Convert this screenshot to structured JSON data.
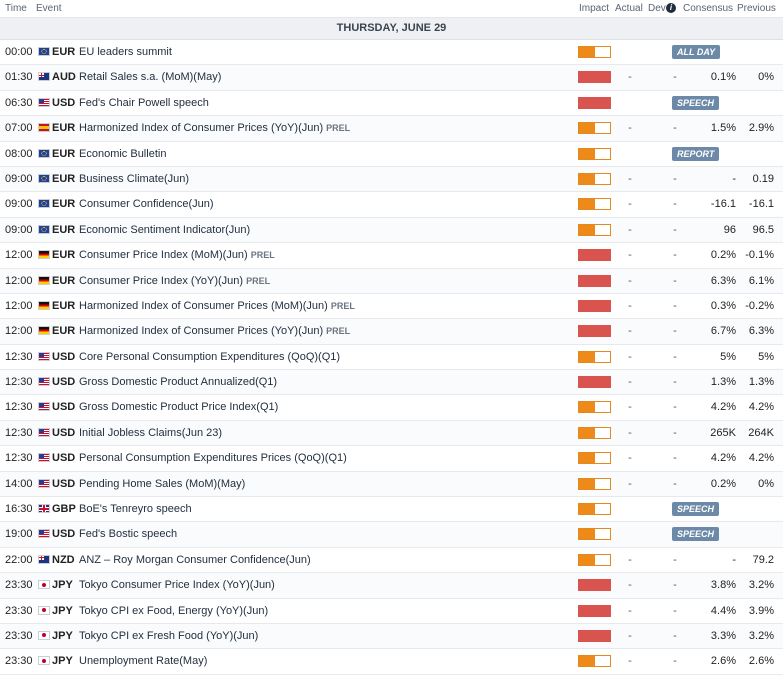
{
  "header": {
    "time": "Time",
    "event": "Event",
    "impact": "Impact",
    "actual": "Actual",
    "dev": "Dev",
    "info_icon": "i",
    "consensus": "Consensus",
    "previous": "Previous"
  },
  "day_label": "THURSDAY, JUNE 29",
  "colors": {
    "impact_medium": "#ee8a1a",
    "impact_high": "#d9534f",
    "badge": "#6c8aa8",
    "day_bg": "#eef0f3"
  },
  "events": [
    {
      "time": "00:00",
      "flag": "eu",
      "cur": "EUR",
      "event": "EU leaders summit",
      "prel": "",
      "impact": "medium",
      "impact_level": 0.5,
      "actual": "",
      "dev": "",
      "cons": "",
      "prev": "",
      "badge": "ALL DAY"
    },
    {
      "time": "01:30",
      "flag": "au",
      "cur": "AUD",
      "event": "Retail Sales s.a. (MoM)(May)",
      "prel": "",
      "impact": "high",
      "impact_level": 1.0,
      "actual": "-",
      "dev": "-",
      "cons": "0.1%",
      "prev": "0%",
      "badge": ""
    },
    {
      "time": "06:30",
      "flag": "us",
      "cur": "USD",
      "event": "Fed's Chair Powell speech",
      "prel": "",
      "impact": "high",
      "impact_level": 1.0,
      "actual": "",
      "dev": "",
      "cons": "",
      "prev": "",
      "badge": "SPEECH"
    },
    {
      "time": "07:00",
      "flag": "es",
      "cur": "EUR",
      "event": "Harmonized Index of Consumer Prices (YoY)(Jun)",
      "prel": "PREL",
      "impact": "medium",
      "impact_level": 0.5,
      "actual": "-",
      "dev": "-",
      "cons": "1.5%",
      "prev": "2.9%",
      "badge": ""
    },
    {
      "time": "08:00",
      "flag": "eu",
      "cur": "EUR",
      "event": "Economic Bulletin",
      "prel": "",
      "impact": "medium",
      "impact_level": 0.5,
      "actual": "",
      "dev": "",
      "cons": "",
      "prev": "",
      "badge": "REPORT"
    },
    {
      "time": "09:00",
      "flag": "eu",
      "cur": "EUR",
      "event": "Business Climate(Jun)",
      "prel": "",
      "impact": "medium",
      "impact_level": 0.5,
      "actual": "-",
      "dev": "-",
      "cons": "-",
      "prev": "0.19",
      "badge": ""
    },
    {
      "time": "09:00",
      "flag": "eu",
      "cur": "EUR",
      "event": "Consumer Confidence(Jun)",
      "prel": "",
      "impact": "medium",
      "impact_level": 0.5,
      "actual": "-",
      "dev": "-",
      "cons": "-16.1",
      "prev": "-16.1",
      "badge": ""
    },
    {
      "time": "09:00",
      "flag": "eu",
      "cur": "EUR",
      "event": "Economic Sentiment Indicator(Jun)",
      "prel": "",
      "impact": "medium",
      "impact_level": 0.5,
      "actual": "-",
      "dev": "-",
      "cons": "96",
      "prev": "96.5",
      "badge": ""
    },
    {
      "time": "12:00",
      "flag": "de",
      "cur": "EUR",
      "event": "Consumer Price Index (MoM)(Jun)",
      "prel": "PREL",
      "impact": "high",
      "impact_level": 1.0,
      "actual": "-",
      "dev": "-",
      "cons": "0.2%",
      "prev": "-0.1%",
      "badge": ""
    },
    {
      "time": "12:00",
      "flag": "de",
      "cur": "EUR",
      "event": "Consumer Price Index (YoY)(Jun)",
      "prel": "PREL",
      "impact": "high",
      "impact_level": 1.0,
      "actual": "-",
      "dev": "-",
      "cons": "6.3%",
      "prev": "6.1%",
      "badge": ""
    },
    {
      "time": "12:00",
      "flag": "de",
      "cur": "EUR",
      "event": "Harmonized Index of Consumer Prices (MoM)(Jun)",
      "prel": "PREL",
      "impact": "high",
      "impact_level": 1.0,
      "actual": "-",
      "dev": "-",
      "cons": "0.3%",
      "prev": "-0.2%",
      "badge": ""
    },
    {
      "time": "12:00",
      "flag": "de",
      "cur": "EUR",
      "event": "Harmonized Index of Consumer Prices (YoY)(Jun)",
      "prel": "PREL",
      "impact": "high",
      "impact_level": 1.0,
      "actual": "-",
      "dev": "-",
      "cons": "6.7%",
      "prev": "6.3%",
      "badge": ""
    },
    {
      "time": "12:30",
      "flag": "us",
      "cur": "USD",
      "event": "Core Personal Consumption Expenditures (QoQ)(Q1)",
      "prel": "",
      "impact": "medium",
      "impact_level": 0.5,
      "actual": "-",
      "dev": "-",
      "cons": "5%",
      "prev": "5%",
      "badge": ""
    },
    {
      "time": "12:30",
      "flag": "us",
      "cur": "USD",
      "event": "Gross Domestic Product Annualized(Q1)",
      "prel": "",
      "impact": "high",
      "impact_level": 1.0,
      "actual": "-",
      "dev": "-",
      "cons": "1.3%",
      "prev": "1.3%",
      "badge": ""
    },
    {
      "time": "12:30",
      "flag": "us",
      "cur": "USD",
      "event": "Gross Domestic Product Price Index(Q1)",
      "prel": "",
      "impact": "medium",
      "impact_level": 0.5,
      "actual": "-",
      "dev": "-",
      "cons": "4.2%",
      "prev": "4.2%",
      "badge": ""
    },
    {
      "time": "12:30",
      "flag": "us",
      "cur": "USD",
      "event": "Initial Jobless Claims(Jun 23)",
      "prel": "",
      "impact": "medium",
      "impact_level": 0.5,
      "actual": "-",
      "dev": "-",
      "cons": "265K",
      "prev": "264K",
      "badge": ""
    },
    {
      "time": "12:30",
      "flag": "us",
      "cur": "USD",
      "event": "Personal Consumption Expenditures Prices (QoQ)(Q1)",
      "prel": "",
      "impact": "medium",
      "impact_level": 0.5,
      "actual": "-",
      "dev": "-",
      "cons": "4.2%",
      "prev": "4.2%",
      "badge": ""
    },
    {
      "time": "14:00",
      "flag": "us",
      "cur": "USD",
      "event": "Pending Home Sales (MoM)(May)",
      "prel": "",
      "impact": "medium",
      "impact_level": 0.5,
      "actual": "-",
      "dev": "-",
      "cons": "0.2%",
      "prev": "0%",
      "badge": ""
    },
    {
      "time": "16:30",
      "flag": "gb",
      "cur": "GBP",
      "event": "BoE's Tenreyro speech",
      "prel": "",
      "impact": "medium",
      "impact_level": 0.5,
      "actual": "",
      "dev": "",
      "cons": "",
      "prev": "",
      "badge": "SPEECH"
    },
    {
      "time": "19:00",
      "flag": "us",
      "cur": "USD",
      "event": "Fed's Bostic speech",
      "prel": "",
      "impact": "medium",
      "impact_level": 0.5,
      "actual": "",
      "dev": "",
      "cons": "",
      "prev": "",
      "badge": "SPEECH"
    },
    {
      "time": "22:00",
      "flag": "nz",
      "cur": "NZD",
      "event": "ANZ – Roy Morgan Consumer Confidence(Jun)",
      "prel": "",
      "impact": "medium",
      "impact_level": 0.5,
      "actual": "-",
      "dev": "-",
      "cons": "-",
      "prev": "79.2",
      "badge": ""
    },
    {
      "time": "23:30",
      "flag": "jp",
      "cur": "JPY",
      "event": "Tokyo Consumer Price Index (YoY)(Jun)",
      "prel": "",
      "impact": "high",
      "impact_level": 1.0,
      "actual": "-",
      "dev": "-",
      "cons": "3.8%",
      "prev": "3.2%",
      "badge": ""
    },
    {
      "time": "23:30",
      "flag": "jp",
      "cur": "JPY",
      "event": "Tokyo CPI ex Food, Energy (YoY)(Jun)",
      "prel": "",
      "impact": "high",
      "impact_level": 1.0,
      "actual": "-",
      "dev": "-",
      "cons": "4.4%",
      "prev": "3.9%",
      "badge": ""
    },
    {
      "time": "23:30",
      "flag": "jp",
      "cur": "JPY",
      "event": "Tokyo CPI ex Fresh Food (YoY)(Jun)",
      "prel": "",
      "impact": "high",
      "impact_level": 1.0,
      "actual": "-",
      "dev": "-",
      "cons": "3.3%",
      "prev": "3.2%",
      "badge": ""
    },
    {
      "time": "23:30",
      "flag": "jp",
      "cur": "JPY",
      "event": "Unemployment Rate(May)",
      "prel": "",
      "impact": "medium",
      "impact_level": 0.5,
      "actual": "-",
      "dev": "-",
      "cons": "2.6%",
      "prev": "2.6%",
      "badge": ""
    }
  ]
}
